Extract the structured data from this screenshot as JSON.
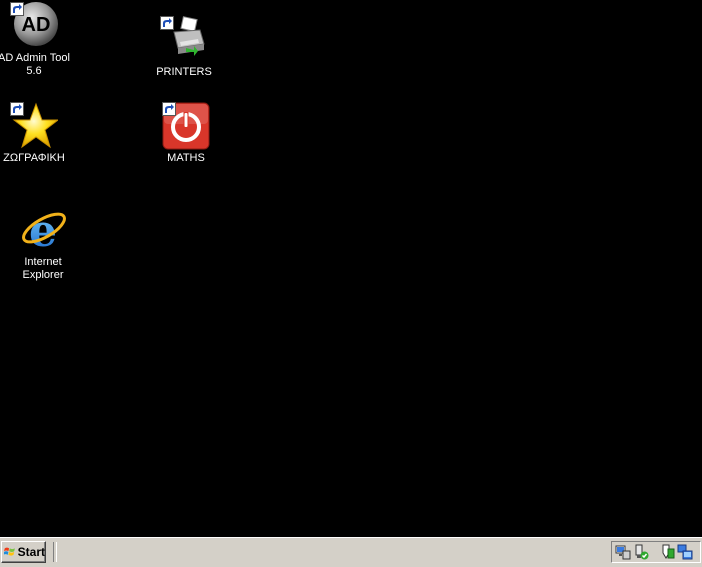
{
  "desktop": {
    "icons": [
      {
        "label_line1": "AD Admin Tool",
        "label_line2": "5.6"
      },
      {
        "label_line1": "PRINTERS",
        "label_line2": ""
      },
      {
        "label_line1": "ΖΩΓΡΑΦΙΚΗ",
        "label_line2": ""
      },
      {
        "label_line1": "MATHS",
        "label_line2": ""
      },
      {
        "label_line1": "Internet",
        "label_line2": "Explorer"
      }
    ],
    "ad_logo_text": "AD"
  },
  "taskbar": {
    "start_label": "Start",
    "tray_icons": [
      "network-icon",
      "safely-remove-icon",
      "security-shield-icon",
      "network-connection-icon"
    ]
  },
  "colors": {
    "desktop_bg": "#000000",
    "taskbar_bg": "#d4d0c8",
    "icon_label": "#ffffff",
    "maths_red": "#d9362a"
  }
}
